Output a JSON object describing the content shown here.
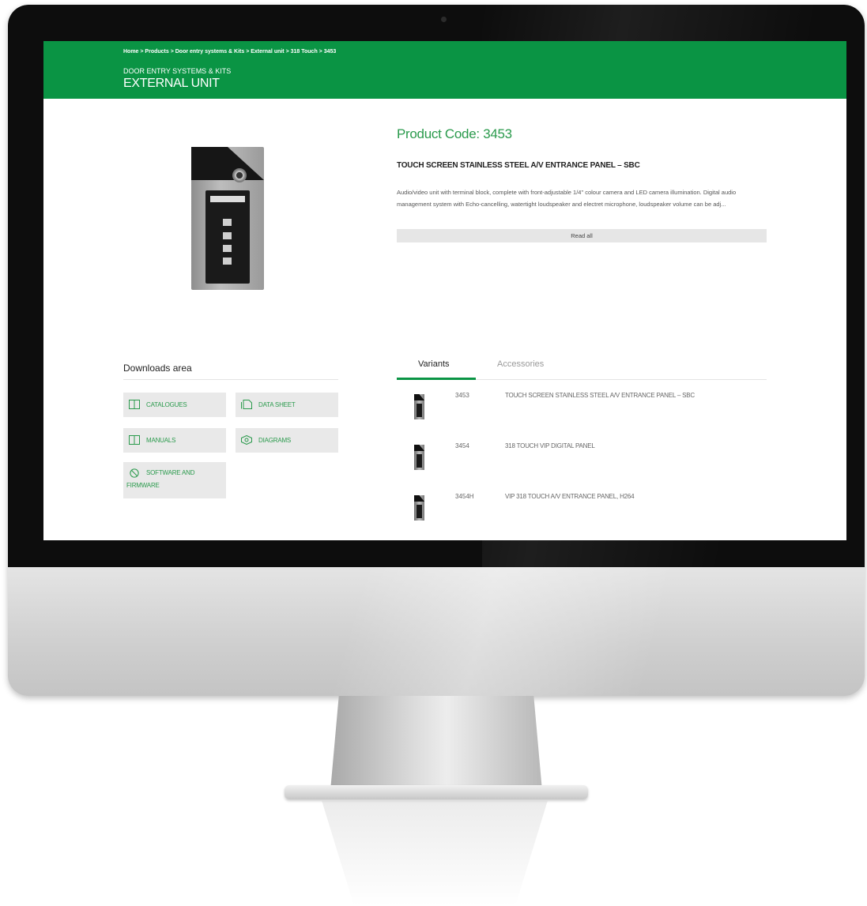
{
  "breadcrumb": "Home > Products > Door entry systems & Kits > External unit > 318 Touch > 3453",
  "category": "DOOR ENTRY SYSTEMS & KITS",
  "page_title": "EXTERNAL UNIT",
  "product": {
    "code_label": "Product Code: 3453",
    "name": "TOUCH SCREEN STAINLESS STEEL A/V ENTRANCE PANEL – SBC",
    "description": "Audio/video unit with terminal block, complete with front-adjustable 1/4\" colour camera and LED camera illumination. Digital audio management system with Echo-cancelling, watertight loudspeaker and electret microphone, loudspeaker volume can be adj...",
    "read_all": "Read all"
  },
  "downloads": {
    "title": "Downloads area",
    "buttons": [
      {
        "label": "CATALOGUES",
        "icon": "book-icon"
      },
      {
        "label": "DATA SHEET",
        "icon": "document-icon"
      },
      {
        "label": "MANUALS",
        "icon": "book-icon"
      },
      {
        "label": "DIAGRAMS",
        "icon": "diagram-icon"
      },
      {
        "label": "SOFTWARE AND FIRMWARE",
        "icon": "no-entry-icon"
      }
    ]
  },
  "tabs": {
    "variants": "Variants",
    "accessories": "Accessories"
  },
  "variants": [
    {
      "code": "3453",
      "name": "TOUCH SCREEN STAINLESS STEEL A/V ENTRANCE PANEL – SBC"
    },
    {
      "code": "3454",
      "name": "318 TOUCH VIP DIGITAL PANEL"
    },
    {
      "code": "3454H",
      "name": "VIP 318 TOUCH A/V ENTRANCE PANEL, H264"
    }
  ],
  "colors": {
    "brand_green": "#0a9444",
    "accent_green_text": "#2a9a4c",
    "button_grey": "#e9e9e9"
  }
}
